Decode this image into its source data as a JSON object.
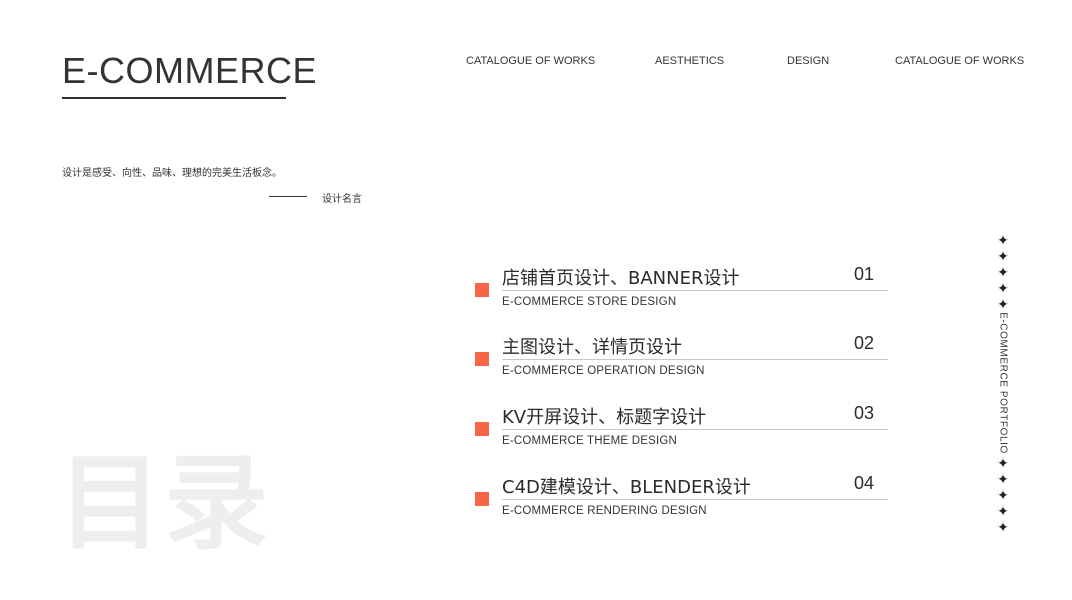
{
  "brand": {
    "title": "E-COMMERCE"
  },
  "nav": [
    "CATALOGUE OF WORKS",
    "AESTHETICS",
    "DESIGN",
    "CATALOGUE OF WORKS"
  ],
  "quote": {
    "text": "设计是感受、向性、品味、理想的完美生活板念。",
    "source": "设计名言"
  },
  "big_title": "目录",
  "accent_color": "#fa6446",
  "toc": [
    {
      "title": "店铺首页设计、BANNER设计",
      "num": "01",
      "sub": "E-COMMERCE STORE DESIGN"
    },
    {
      "title": "主图设计、详情页设计",
      "num": "02",
      "sub": "E-COMMERCE OPERATION DESIGN"
    },
    {
      "title": "KV开屏设计、标题字设计",
      "num": "03",
      "sub": "E-COMMERCE THEME DESIGN"
    },
    {
      "title": "C4D建模设计、BLENDER设计",
      "num": "04",
      "sub": "E-COMMERCE RENDERING DESIGN"
    }
  ],
  "sidebar": {
    "star_glyph": "✦",
    "vertical_text": "E-COMMERCE PORTFOLIO"
  }
}
